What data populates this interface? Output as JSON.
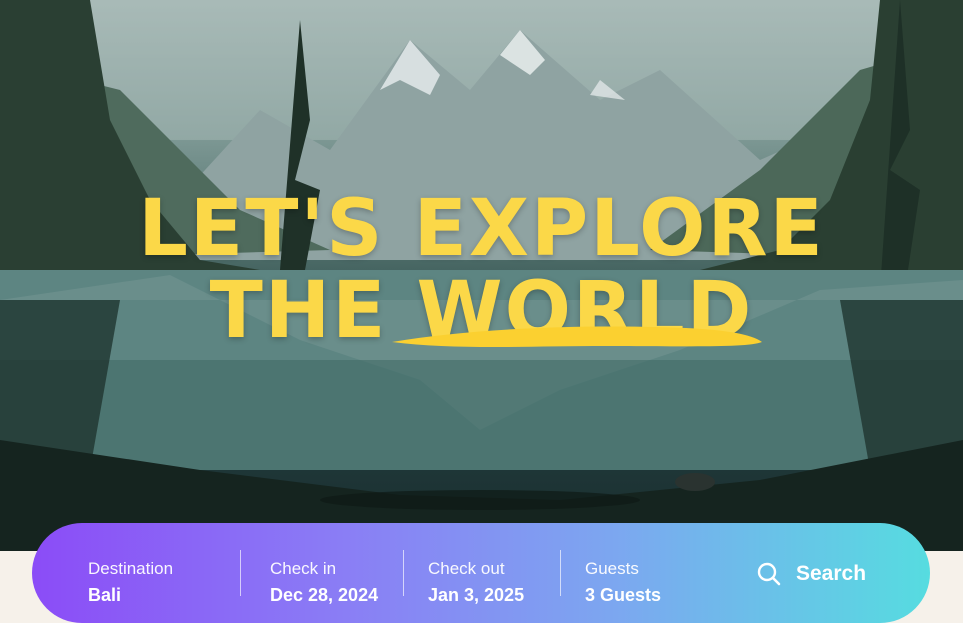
{
  "hero": {
    "headline_line1": "LET'S EXPLORE",
    "headline_line2": "THE WORLD"
  },
  "search": {
    "destination": {
      "label": "Destination",
      "value": "Bali"
    },
    "check_in": {
      "label": "Check in",
      "value": "Dec 28, 2024"
    },
    "check_out": {
      "label": "Check out",
      "value": "Jan 3, 2025"
    },
    "guests": {
      "label": "Guests",
      "value": "3 Guests"
    },
    "button_label": "Search",
    "button_icon": "search-icon"
  },
  "colors": {
    "headline": "#fbd848",
    "gradient_start": "#8b4cf7",
    "gradient_end": "#56dce0"
  }
}
